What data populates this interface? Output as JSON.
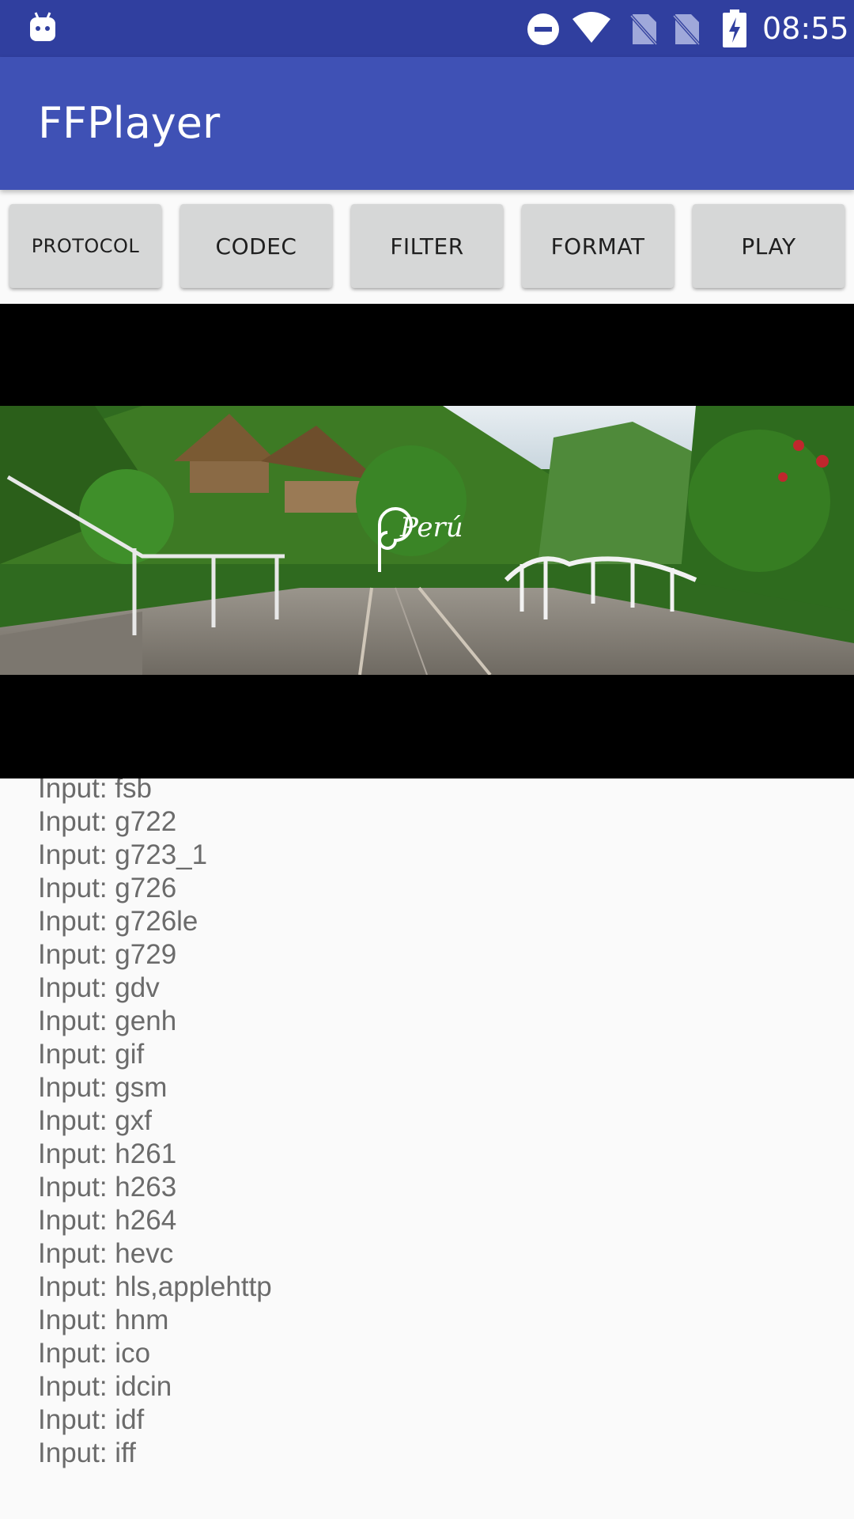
{
  "status_bar": {
    "time": "08:55",
    "icons": [
      "android-icon",
      "do-not-disturb-icon",
      "wifi-icon",
      "no-sim-icon",
      "no-sim-icon",
      "battery-charging-icon"
    ]
  },
  "app_bar": {
    "title": "FFPlayer"
  },
  "buttons": {
    "protocol": "PROTOCOL",
    "codec": "CODEC",
    "filter": "FILTER",
    "format": "FORMAT",
    "play": "PLAY"
  },
  "video": {
    "watermark": "Perú"
  },
  "log": {
    "lines": [
      "Input: fsb",
      "Input: g722",
      "Input: g723_1",
      "Input: g726",
      "Input: g726le",
      "Input: g729",
      "Input: gdv",
      "Input: genh",
      "Input: gif",
      "Input: gsm",
      "Input: gxf",
      "Input: h261",
      "Input: h263",
      "Input: h264",
      "Input: hevc",
      "Input: hls,applehttp",
      "Input: hnm",
      "Input: ico",
      "Input: idcin",
      "Input: idf",
      "Input: iff"
    ]
  },
  "colors": {
    "status_bar": "#303f9f",
    "app_bar": "#3f51b5",
    "button": "#d6d7d7",
    "log_text": "#6b6b6b"
  }
}
